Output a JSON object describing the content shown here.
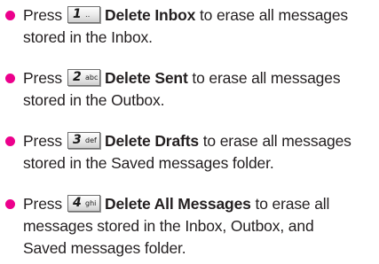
{
  "accent_color": "#ec008c",
  "items": [
    {
      "press": "Press",
      "key_digit": "1",
      "key_sub": "‥",
      "command": "Delete Inbox",
      "desc_line1": " to erase all messages",
      "desc_line2": "stored in the Inbox."
    },
    {
      "press": "Press",
      "key_digit": "2",
      "key_sub": "abc",
      "command": "Delete Sent",
      "desc_line1": " to erase all messages",
      "desc_line2": "stored in the Outbox."
    },
    {
      "press": "Press",
      "key_digit": "3",
      "key_sub": "def",
      "command": "Delete Drafts",
      "desc_line1": " to erase all messages",
      "desc_line2": "stored in the Saved messages folder."
    },
    {
      "press": "Press",
      "key_digit": "4",
      "key_sub": "ghi",
      "command": "Delete All Messages",
      "desc_line1": " to erase all",
      "desc_line2": "messages stored in the Inbox, Outbox, and",
      "desc_line3": "Saved messages folder."
    }
  ]
}
